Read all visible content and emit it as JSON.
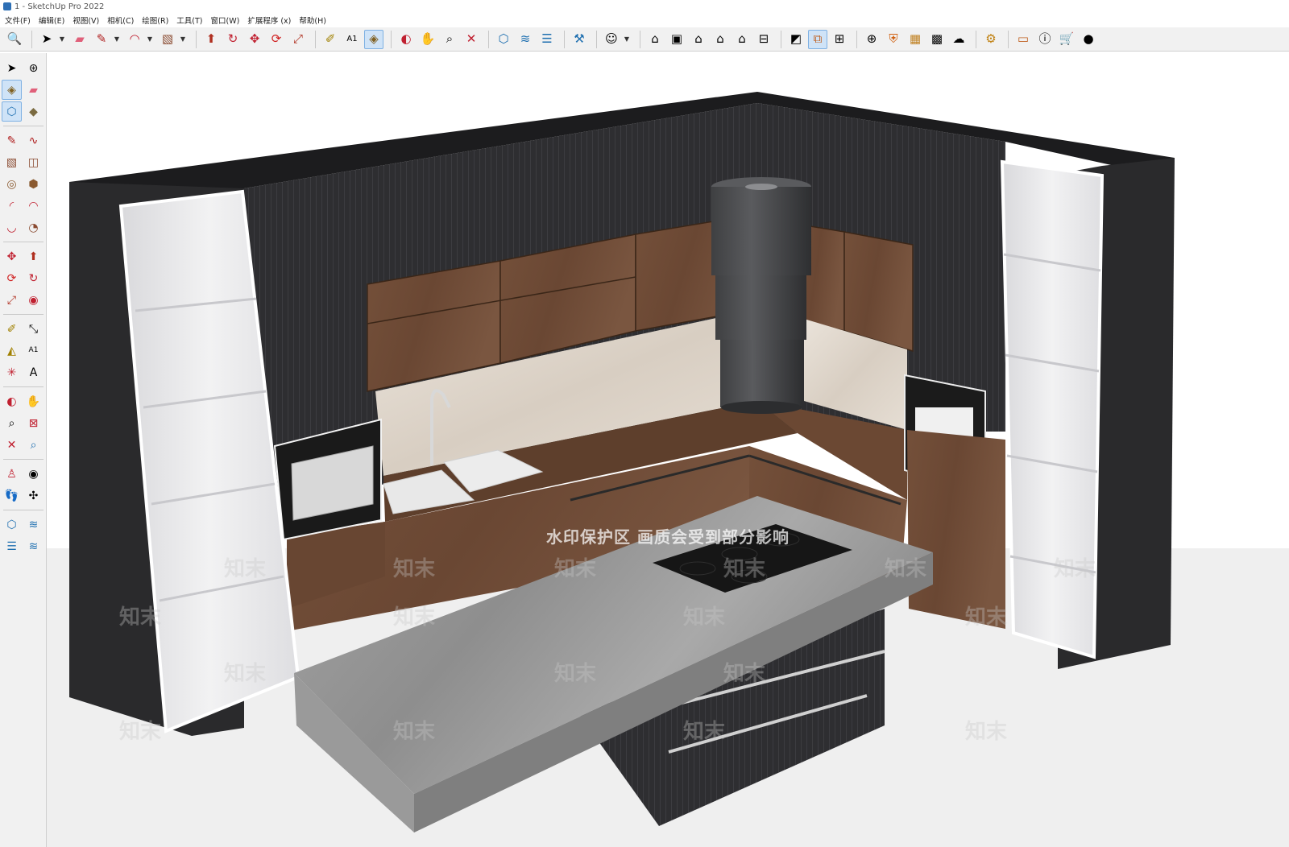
{
  "window": {
    "title": "1 - SketchUp Pro 2022"
  },
  "menu": [
    "文件(F)",
    "编辑(E)",
    "视图(V)",
    "相机(C)",
    "绘图(R)",
    "工具(T)",
    "窗口(W)",
    "扩展程序 (x)",
    "帮助(H)"
  ],
  "toolbar": {
    "groups": [
      [
        "search-icon"
      ],
      [
        "select-icon",
        "eraser-icon",
        "pencil-icon",
        "arc-icon",
        "rectangle-icon"
      ],
      [
        "push-pull-icon",
        "follow-me-icon",
        "move-icon",
        "rotate-icon",
        "scale-icon"
      ],
      [
        "tape-measure-icon",
        "text-icon",
        "paint-bucket-icon"
      ],
      [
        "orbit-icon",
        "pan-icon",
        "zoom-icon",
        "zoom-extents-icon"
      ],
      [
        "component-icon",
        "layer-stack-icon",
        "layer-stack-alt-icon"
      ],
      [
        "solid-tools-icon"
      ],
      [
        "user-profile-icon"
      ],
      [
        "iso-view-icon",
        "top-view-icon",
        "front-view-icon",
        "right-view-icon",
        "back-view-icon",
        "left-view-icon"
      ],
      [
        "style-icon",
        "section-icon",
        "warehouse-icon"
      ],
      [
        "add-icon",
        "shield-icon",
        "map-icon",
        "checker-icon",
        "cloud-icon"
      ],
      [
        "settings-icon"
      ],
      [
        "window-icon",
        "info-icon",
        "cart-icon",
        "account-icon"
      ]
    ],
    "active": [
      "paint-bucket-icon",
      "section-icon"
    ]
  },
  "left_toolbar": {
    "rows": [
      [
        "select-icon",
        "orbit-small-icon"
      ],
      [
        "paint-bucket-icon",
        "eraser-icon"
      ],
      [
        "component-icon",
        "tag-icon"
      ],
      [
        "line-icon",
        "freehand-icon"
      ],
      [
        "rectangle-icon",
        "rotated-rectangle-icon"
      ],
      [
        "circle-icon",
        "polygon-icon"
      ],
      [
        "arc-icon",
        "two-point-arc-icon"
      ],
      [
        "three-point-arc-icon",
        "pie-icon"
      ],
      [
        "move-icon",
        "push-pull-icon"
      ],
      [
        "rotate-icon",
        "follow-me-icon"
      ],
      [
        "scale-icon",
        "offset-icon"
      ],
      [
        "tape-measure-icon",
        "dimension-icon"
      ],
      [
        "protractor-icon",
        "text-icon"
      ],
      [
        "axes-icon",
        "3d-text-icon"
      ],
      [
        "orbit-icon",
        "pan-icon"
      ],
      [
        "zoom-icon",
        "zoom-window-icon"
      ],
      [
        "zoom-extents-icon",
        "previous-view-icon"
      ],
      [
        "position-camera-icon",
        "look-around-icon"
      ],
      [
        "walk-icon",
        "section-plane-icon"
      ],
      [
        "solid-tools-icon",
        "sandbox-icon"
      ],
      [
        "layer-stack-icon",
        "sandbox-alt-icon"
      ]
    ],
    "separators_after": [
      2,
      7,
      10,
      13,
      16,
      18
    ],
    "active": [
      "paint-bucket-icon",
      "component-icon"
    ]
  },
  "viewport": {
    "watermark_text": "水印保护区   画质会受到部分影响",
    "logo_text": "知末"
  },
  "colors": {
    "wall_dark": "#2c2c2e",
    "wall_top": "#1f1f21",
    "wood": "#6e4b36",
    "marble_backsplash": "#e3dad0",
    "island_top": "#9a9a9a",
    "glass_cabinet": "#e8e8ea",
    "hood": "#4a4b4d"
  }
}
